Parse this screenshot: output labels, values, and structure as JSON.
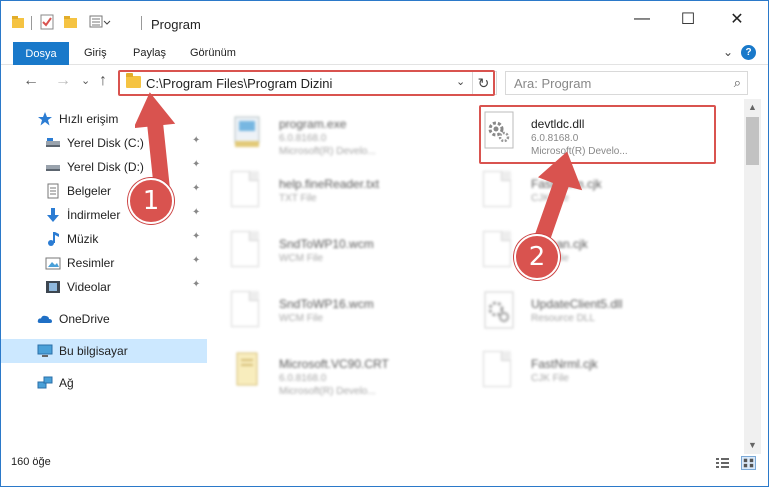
{
  "window": {
    "title": "Program",
    "minimize": "—",
    "maximize": "☐",
    "close": "✕"
  },
  "ribbon": {
    "tabs": [
      "Dosya",
      "Giriş",
      "Paylaş",
      "Görünüm"
    ],
    "expand": "⌄",
    "help": "?"
  },
  "nav": {
    "back": "←",
    "forward": "→",
    "recent": "⌄",
    "up": "↑",
    "address": "C:\\Program Files\\Program Dizini",
    "dropdown": "⌄",
    "refresh": "↻",
    "search_placeholder": "Ara: Program",
    "search_glyph": "⌕"
  },
  "sidebar": {
    "items": [
      {
        "label": "Hızlı erişim",
        "icon": "star-icon",
        "pinned": false
      },
      {
        "label": "Yerel Disk (C:)",
        "icon": "drive-icon",
        "pinned": true
      },
      {
        "label": "Yerel Disk (D:)",
        "icon": "drive-icon",
        "pinned": true
      },
      {
        "label": "Belgeler",
        "icon": "documents-icon",
        "pinned": true
      },
      {
        "label": "İndirmeler",
        "icon": "download-icon",
        "pinned": true
      },
      {
        "label": "Müzik",
        "icon": "music-icon",
        "pinned": true
      },
      {
        "label": "Resimler",
        "icon": "pictures-icon",
        "pinned": true
      },
      {
        "label": "Videolar",
        "icon": "videos-icon",
        "pinned": true
      },
      {
        "label": "OneDrive",
        "icon": "cloud-icon",
        "pinned": false
      },
      {
        "label": "Bu bilgisayar",
        "icon": "computer-icon",
        "pinned": false
      },
      {
        "label": "Ağ",
        "icon": "network-icon",
        "pinned": false
      }
    ],
    "pin_glyph": "📌"
  },
  "files": [
    {
      "name": "program.exe",
      "line1": "6.0.8168.0",
      "line2": "Microsoft(R) Develo...",
      "blurred": true
    },
    {
      "name": "devtldc.dll",
      "line1": "6.0.8168.0",
      "line2": "Microsoft(R) Develo...",
      "blurred": false
    },
    {
      "name": "help.fineReader.txt",
      "line1": "TXT File",
      "line2": "",
      "blurred": true
    },
    {
      "name": "FastNorm.cjk",
      "line1": "CJK File",
      "line2": "",
      "blurred": true
    },
    {
      "name": "SndToWP10.wcm",
      "line1": "WCM File",
      "line2": "",
      "blurred": true
    },
    {
      "name": "Korean.cjk",
      "line1": "CJK File",
      "line2": "",
      "blurred": true
    },
    {
      "name": "SndToWP16.wcm",
      "line1": "WCM File",
      "line2": "",
      "blurred": true
    },
    {
      "name": "UpdateClient5.dll",
      "line1": "Resource DLL",
      "line2": "",
      "blurred": true
    },
    {
      "name": "Microsoft.VC90.CRT",
      "line1": "6.0.8168.0",
      "line2": "Microsoft(R) Develo...",
      "blurred": true
    },
    {
      "name": "FastNrml.cjk",
      "line1": "CJK File",
      "line2": "",
      "blurred": true
    }
  ],
  "scroll": {
    "up": "▲",
    "down": "▼"
  },
  "status": {
    "item_count": "160 öğe"
  },
  "annotations": {
    "step1": "1",
    "step2": "2"
  },
  "colors": {
    "accent": "#1979ca",
    "highlight": "#d9534f",
    "selected": "#cce8ff"
  }
}
